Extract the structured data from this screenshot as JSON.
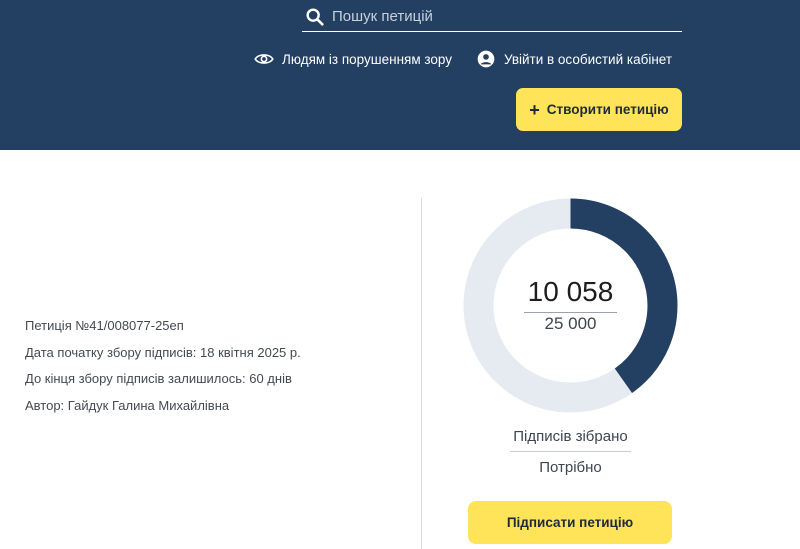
{
  "header": {
    "search_placeholder": "Пошук петицій",
    "search_icon": "search-icon",
    "vision_link": {
      "label": "Людям із порушенням зору",
      "icon": "eye-icon"
    },
    "cabinet_link": {
      "label": "Увійти в особистий кабінет",
      "icon": "user-icon"
    },
    "create_button": {
      "icon": "+",
      "label": "Створити петицію"
    }
  },
  "petition": {
    "number": "Петиція №41/008077-25еп",
    "start_date": "Дата початку збору підписів: 18 квітня 2025 р.",
    "remaining": "До кінця збору підписів залишилось: 60 днів",
    "author": "Автор: Гайдук Галина Михайлівна"
  },
  "progress": {
    "collected": "10 058",
    "required": "25 000",
    "fraction": 0.4023,
    "collected_label": "Підписів зібрано",
    "required_label": "Потрібно",
    "fill_color": "#233f61",
    "track_color": "#e6ebf1"
  },
  "sign_button": {
    "label": "Підписати петицію"
  },
  "colors": {
    "header_bg": "#233f61",
    "accent_yellow": "#ffe358"
  }
}
